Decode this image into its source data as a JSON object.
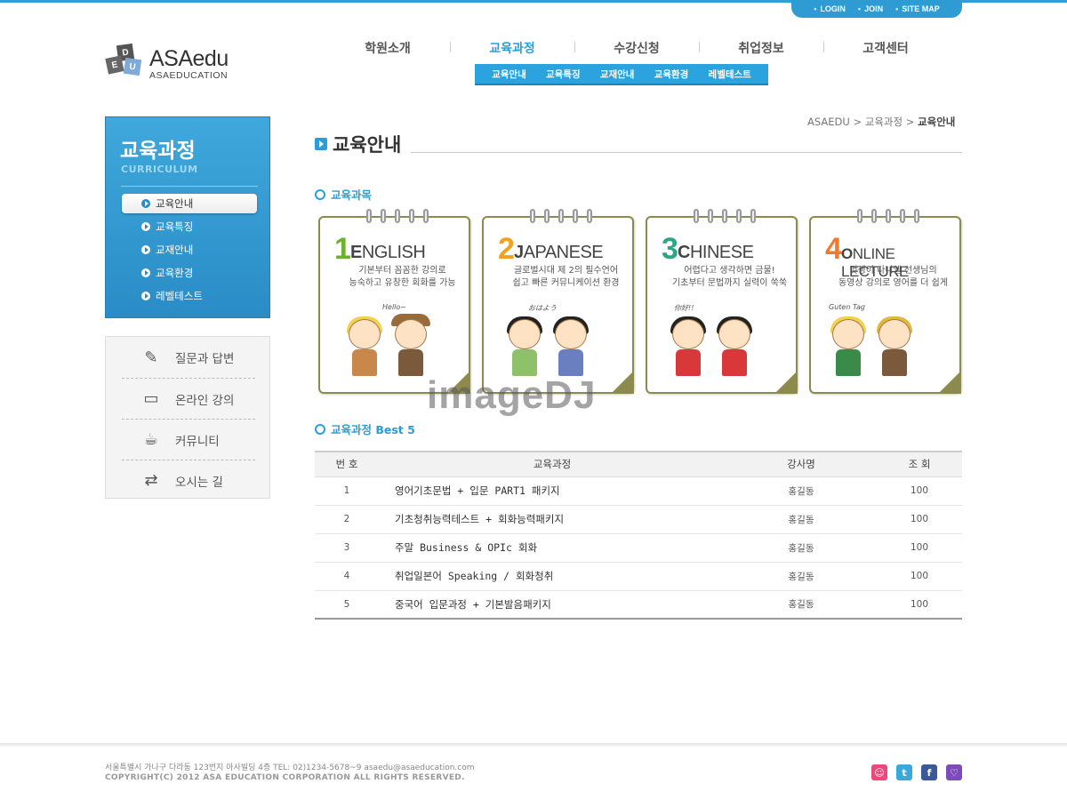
{
  "util_nav": [
    "LOGIN",
    "JOIN",
    "SITE MAP"
  ],
  "logo": {
    "cube_letters": [
      "D",
      "E",
      "U"
    ],
    "name": "ASAedu",
    "sub": "ASAEDUCATION"
  },
  "gnb": [
    "학원소개",
    "교육과정",
    "수강신청",
    "취업정보",
    "고객센터"
  ],
  "subnav": [
    "교육안내",
    "교육특징",
    "교재안내",
    "교육환경",
    "레벨테스트"
  ],
  "lnb": {
    "title": "교육과정",
    "subtitle": "CURRICULUM",
    "items": [
      "교육안내",
      "교육특징",
      "교재안내",
      "교육환경",
      "레벨테스트"
    ],
    "active_index": 0
  },
  "quick": [
    {
      "label": "질문과 답변",
      "icon": "qa-pencil-icon"
    },
    {
      "label": "온라인 강의",
      "icon": "online-lecture-icon"
    },
    {
      "label": "커뮤니티",
      "icon": "coffee-cup-icon"
    },
    {
      "label": "오시는 길",
      "icon": "direction-arrows-icon"
    }
  ],
  "breadcrumb": {
    "home": "ASAEDU",
    "sep": ">",
    "level1": "교육과정",
    "current": "교육안내"
  },
  "page_title": "교육안내",
  "section1": "교육과목",
  "cards": [
    {
      "num": "1",
      "title_first": "E",
      "title_rest": "NGLISH",
      "color": "#6bb22e",
      "desc1": "기본부터 꼼꼼한 강의로",
      "desc2": "능숙하고 유창한 회화를 가능",
      "bubble": "Hello~"
    },
    {
      "num": "2",
      "title_first": "J",
      "title_rest": "APANESE",
      "color": "#f0a21c",
      "desc1": "글로벌시대 제 2의 필수언어",
      "desc2": "쉽고 빠른 커뮤니케이션 환경",
      "bubble": "おはよう"
    },
    {
      "num": "3",
      "title_first": "C",
      "title_rest": "HINESE",
      "color": "#2ea584",
      "desc1": "어렵다고 생각하면 금물!",
      "desc2": "기초부터 문법까지 실력이 쑥쑥",
      "bubble": "你好!!"
    },
    {
      "num": "4",
      "title_first": "O",
      "title_rest": "NLINE LECTURE",
      "color": "#f07a2a",
      "desc1": "멋쟁이 다니엘 선생님의",
      "desc2": "동영상 강의로 영어를 더 쉽게",
      "bubble": "Guten Tag"
    }
  ],
  "watermark": "imageDJ",
  "section2": "교육과정 Best 5",
  "table": {
    "headers": [
      "번 호",
      "교육과정",
      "강사명",
      "조 회"
    ],
    "rows": [
      {
        "no": "1",
        "course": "영어기초문법 + 입문 PART1 패키지",
        "teacher": "홍길동",
        "views": "100"
      },
      {
        "no": "2",
        "course": "기초청취능력테스트 + 회화능력패키지",
        "teacher": "홍길동",
        "views": "100"
      },
      {
        "no": "3",
        "course": "주말 Business & OPIc 회화",
        "teacher": "홍길동",
        "views": "100"
      },
      {
        "no": "4",
        "course": "취업일본어 Speaking / 회화청취",
        "teacher": "홍길동",
        "views": "100"
      },
      {
        "no": "5",
        "course": "중국어 입문과정 + 기본발음패키지",
        "teacher": "홍길동",
        "views": "100"
      }
    ]
  },
  "footer": {
    "address": "서울특별시 가나구 다라동 123번지 아사빌딩 4층   TEL: 02)1234-5678~9   asaedu@asaeducation.com",
    "copyright": "COPYRIGHT(C) 2012 ASA EDUCATION CORPORATION ALL RIGHTS RESERVED."
  },
  "sns": [
    {
      "name": "me2day-icon",
      "color": "#e84a7a"
    },
    {
      "name": "twitter-icon",
      "color": "#39a9dc"
    },
    {
      "name": "facebook-icon",
      "color": "#3b5998"
    },
    {
      "name": "yozm-icon",
      "color": "#7e4cb8"
    }
  ]
}
